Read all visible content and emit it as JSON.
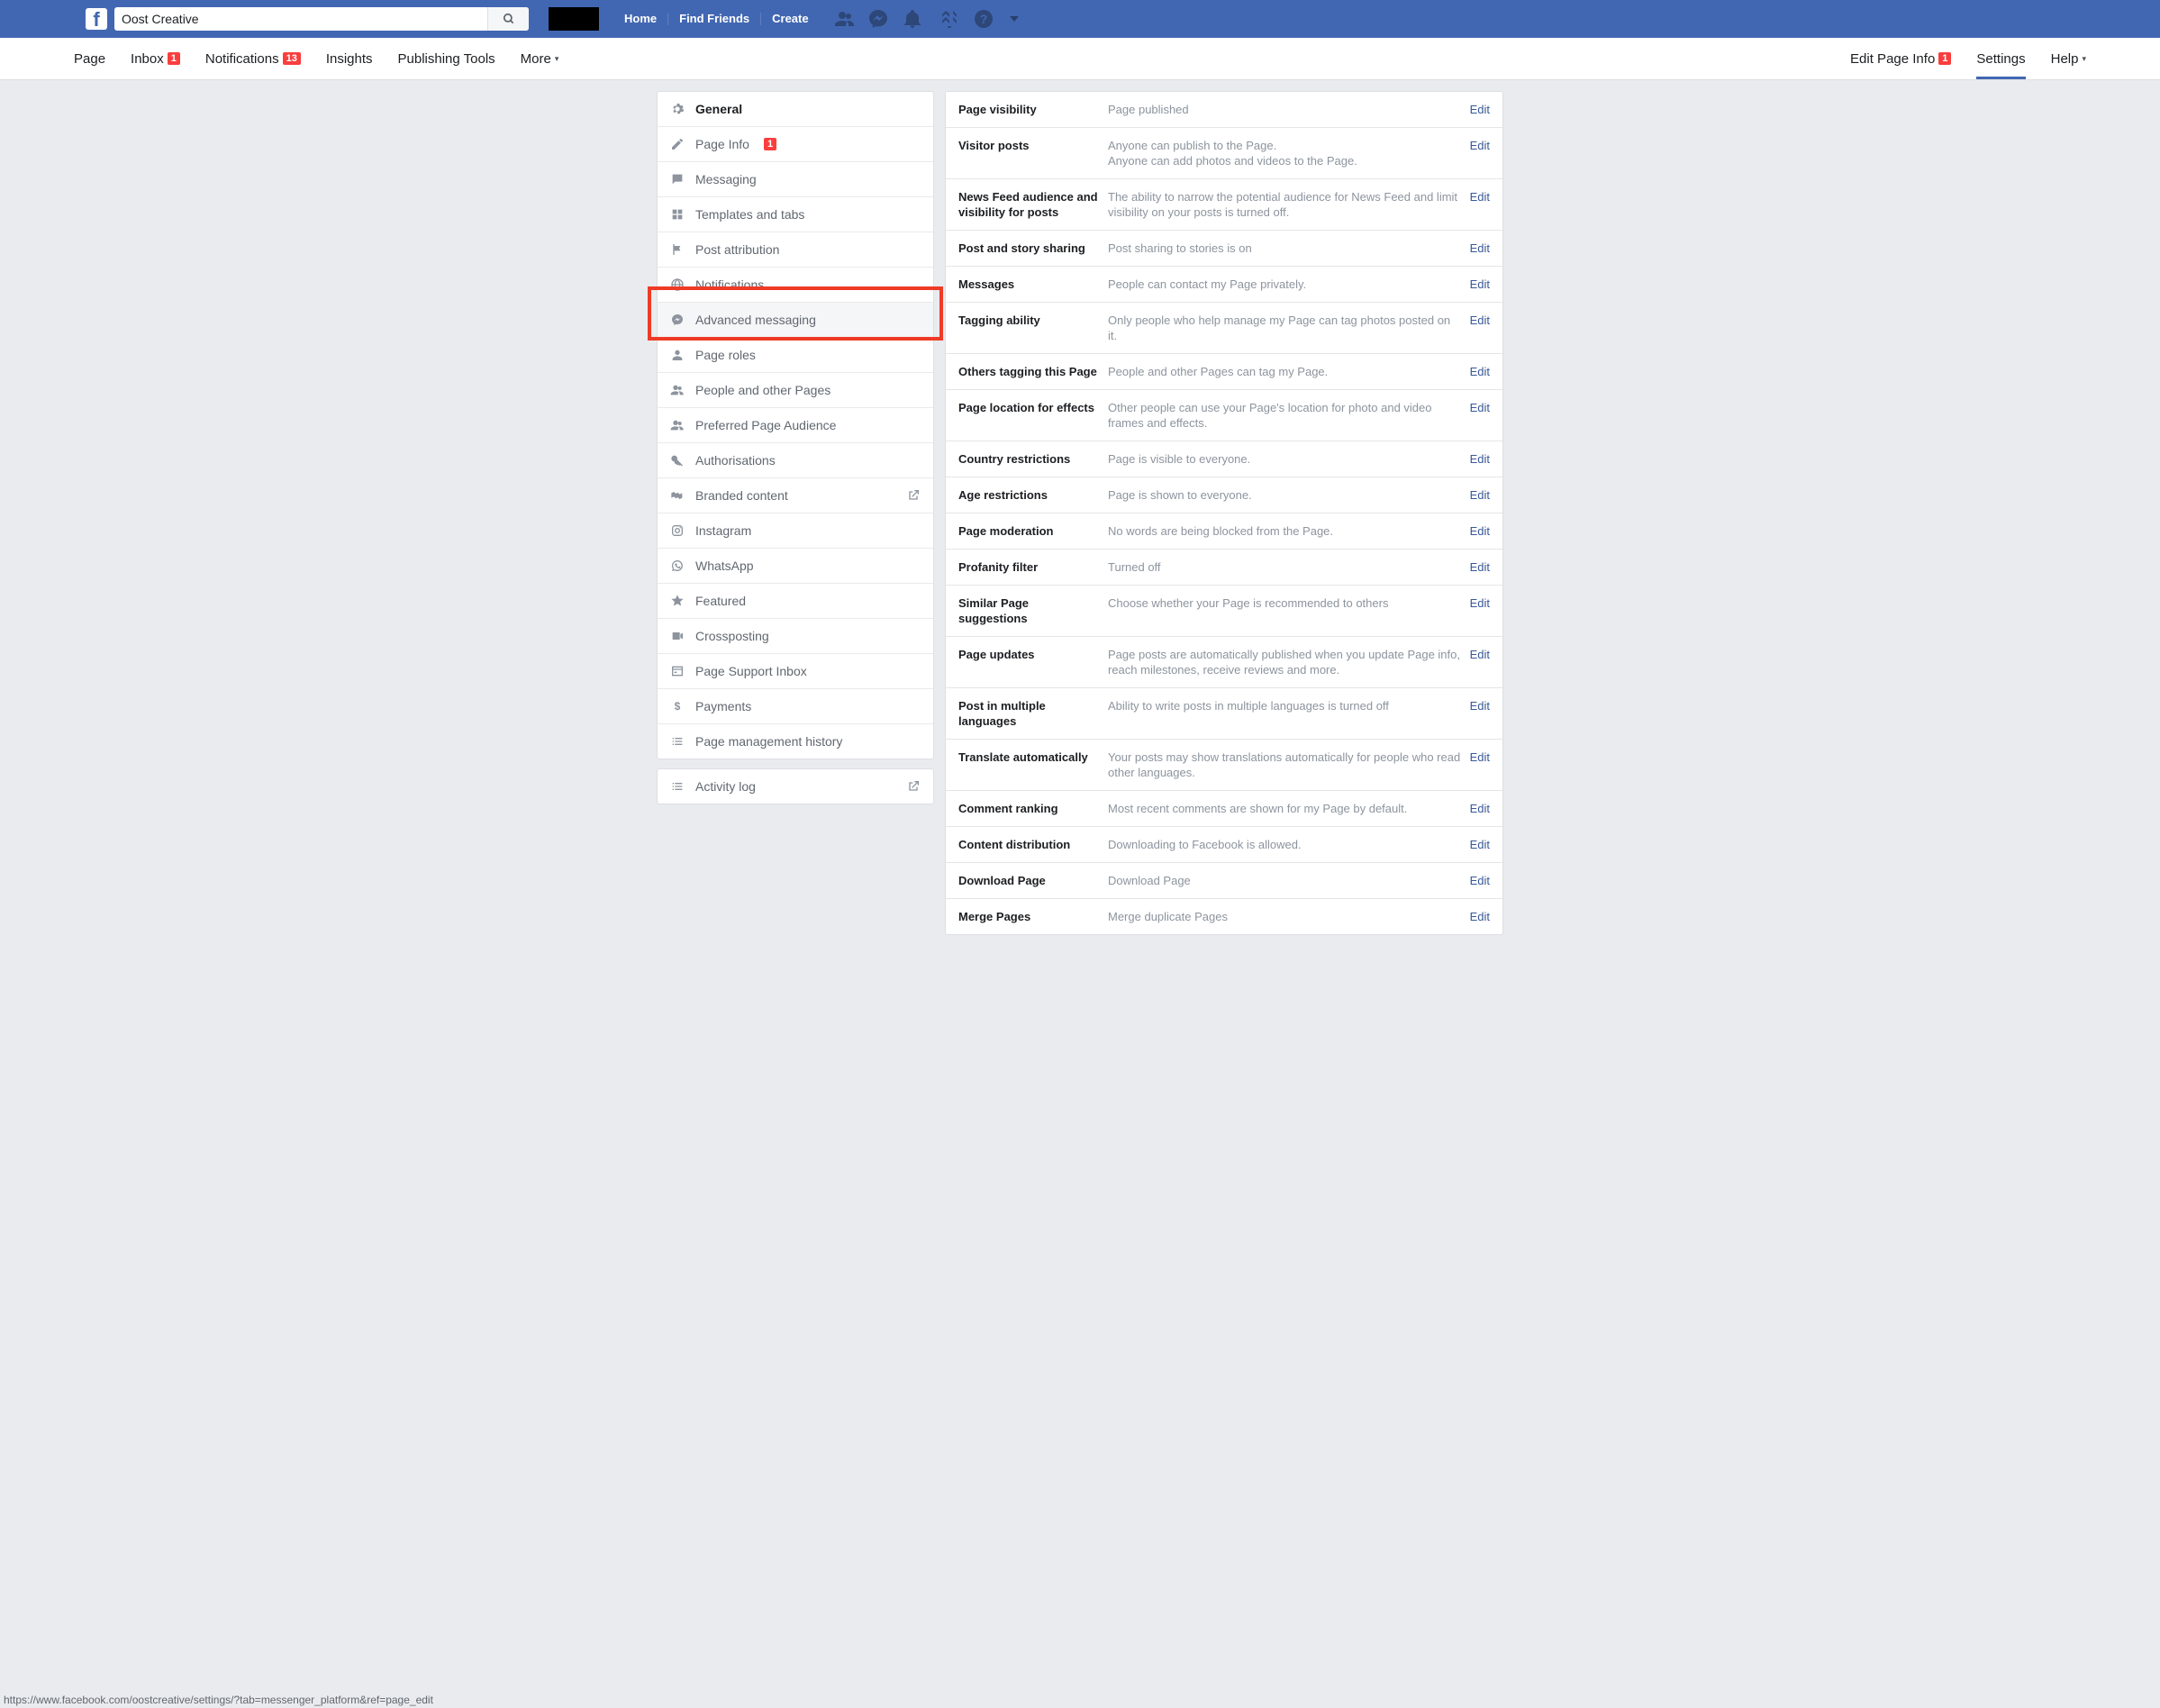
{
  "search": {
    "value": "Oost Creative"
  },
  "topnav": {
    "home": "Home",
    "findfriends": "Find Friends",
    "create": "Create"
  },
  "pagenav": {
    "left": {
      "page": "Page",
      "inbox": "Inbox",
      "inbox_badge": "1",
      "notifications": "Notifications",
      "notifications_badge": "13",
      "insights": "Insights",
      "publishing": "Publishing Tools",
      "more": "More"
    },
    "right": {
      "editpage": "Edit Page Info",
      "editpage_badge": "1",
      "settings": "Settings",
      "help": "Help"
    }
  },
  "sidebar": [
    {
      "label": "General",
      "icon": "gear-icon",
      "active": true
    },
    {
      "label": "Page Info",
      "icon": "pencil-icon",
      "badge": "1"
    },
    {
      "label": "Messaging",
      "icon": "chat-icon"
    },
    {
      "label": "Templates and tabs",
      "icon": "grid-icon"
    },
    {
      "label": "Post attribution",
      "icon": "flag-icon"
    },
    {
      "label": "Notifications",
      "icon": "globe-icon"
    },
    {
      "label": "Advanced messaging",
      "icon": "messenger-icon",
      "highlighted": true
    },
    {
      "label": "Page roles",
      "icon": "person-icon"
    },
    {
      "label": "People and other Pages",
      "icon": "people-icon"
    },
    {
      "label": "Preferred Page Audience",
      "icon": "people-icon"
    },
    {
      "label": "Authorisations",
      "icon": "key-icon"
    },
    {
      "label": "Branded content",
      "icon": "handshake-icon",
      "trailing": "exit-icon"
    },
    {
      "label": "Instagram",
      "icon": "instagram-icon"
    },
    {
      "label": "WhatsApp",
      "icon": "whatsapp-icon"
    },
    {
      "label": "Featured",
      "icon": "star-icon"
    },
    {
      "label": "Crossposting",
      "icon": "video-icon"
    },
    {
      "label": "Page Support Inbox",
      "icon": "card-icon"
    },
    {
      "label": "Payments",
      "icon": "dollar-icon"
    },
    {
      "label": "Page management history",
      "icon": "list-icon"
    }
  ],
  "activity": {
    "label": "Activity log",
    "icon": "list-icon",
    "trailing": "exit-icon"
  },
  "settings_rows": [
    {
      "label": "Page visibility",
      "desc": "Page published"
    },
    {
      "label": "Visitor posts",
      "desc": "Anyone can publish to the Page.\nAnyone can add photos and videos to the Page."
    },
    {
      "label": "News Feed audience and visibility for posts",
      "desc": "The ability to narrow the potential audience for News Feed and limit visibility on your posts is turned off."
    },
    {
      "label": "Post and story sharing",
      "desc": "Post sharing to stories is on"
    },
    {
      "label": "Messages",
      "desc": "People can contact my Page privately."
    },
    {
      "label": "Tagging ability",
      "desc": "Only people who help manage my Page can tag photos posted on it."
    },
    {
      "label": "Others tagging this Page",
      "desc": "People and other Pages can tag my Page."
    },
    {
      "label": "Page location for effects",
      "desc": "Other people can use your Page's location for photo and video frames and effects."
    },
    {
      "label": "Country restrictions",
      "desc": "Page is visible to everyone."
    },
    {
      "label": "Age restrictions",
      "desc": "Page is shown to everyone."
    },
    {
      "label": "Page moderation",
      "desc": "No words are being blocked from the Page."
    },
    {
      "label": "Profanity filter",
      "desc": "Turned off"
    },
    {
      "label": "Similar Page suggestions",
      "desc": "Choose whether your Page is recommended to others"
    },
    {
      "label": "Page updates",
      "desc": "Page posts are automatically published when you update Page info, reach milestones, receive reviews and more."
    },
    {
      "label": "Post in multiple languages",
      "desc": "Ability to write posts in multiple languages is turned off"
    },
    {
      "label": "Translate automatically",
      "desc": "Your posts may show translations automatically for people who read other languages."
    },
    {
      "label": "Comment ranking",
      "desc": "Most recent comments are shown for my Page by default."
    },
    {
      "label": "Content distribution",
      "desc": "Downloading to Facebook is allowed."
    },
    {
      "label": "Download Page",
      "desc": "Download Page"
    },
    {
      "label": "Merge Pages",
      "desc": "Merge duplicate Pages"
    }
  ],
  "edit_text": "Edit",
  "statusbar": "https://www.facebook.com/oostcreative/settings/?tab=messenger_platform&ref=page_edit"
}
